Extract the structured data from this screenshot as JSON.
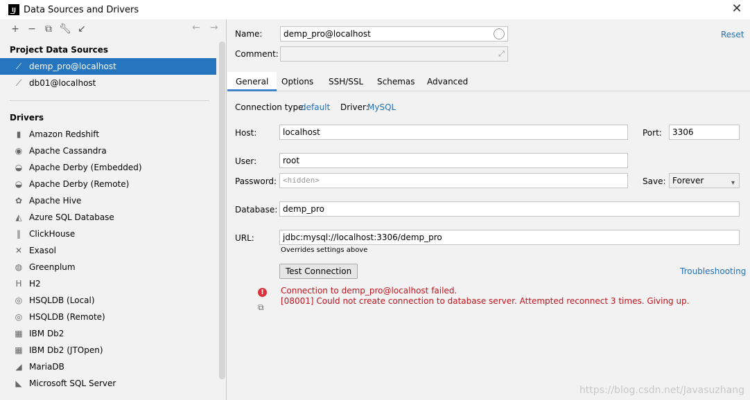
{
  "window": {
    "title": "Data Sources and Drivers",
    "app_icon_text": "IJ"
  },
  "left": {
    "project_section": "Project Data Sources",
    "data_sources": [
      {
        "label": "demp_pro@localhost",
        "icon": "mysql-icon",
        "selected": true
      },
      {
        "label": "db01@localhost",
        "icon": "mysql-icon",
        "selected": false
      }
    ],
    "drivers_section": "Drivers",
    "drivers": [
      {
        "label": "Amazon Redshift",
        "icon": "redshift-icon",
        "glyph": "▮"
      },
      {
        "label": "Apache Cassandra",
        "icon": "cassandra-icon",
        "glyph": "◉"
      },
      {
        "label": "Apache Derby (Embedded)",
        "icon": "derby-icon",
        "glyph": "◒"
      },
      {
        "label": "Apache Derby (Remote)",
        "icon": "derby-icon",
        "glyph": "◒"
      },
      {
        "label": "Apache Hive",
        "icon": "hive-icon",
        "glyph": "✿"
      },
      {
        "label": "Azure SQL Database",
        "icon": "azure-icon",
        "glyph": "◭"
      },
      {
        "label": "ClickHouse",
        "icon": "clickhouse-icon",
        "glyph": "‖"
      },
      {
        "label": "Exasol",
        "icon": "exasol-icon",
        "glyph": "✕"
      },
      {
        "label": "Greenplum",
        "icon": "greenplum-icon",
        "glyph": "◍"
      },
      {
        "label": "H2",
        "icon": "h2-icon",
        "glyph": "H"
      },
      {
        "label": "HSQLDB (Local)",
        "icon": "hsqldb-icon",
        "glyph": "◎"
      },
      {
        "label": "HSQLDB (Remote)",
        "icon": "hsqldb-icon",
        "glyph": "◎"
      },
      {
        "label": "IBM Db2",
        "icon": "ibm-icon",
        "glyph": "▦"
      },
      {
        "label": "IBM Db2 (JTOpen)",
        "icon": "ibm-icon",
        "glyph": "▦"
      },
      {
        "label": "MariaDB",
        "icon": "mariadb-icon",
        "glyph": "◢"
      },
      {
        "label": "Microsoft SQL Server",
        "icon": "mssql-icon",
        "glyph": "◣"
      }
    ]
  },
  "form": {
    "name_label": "Name:",
    "name_value": "demp_pro@localhost",
    "comment_label": "Comment:",
    "reset_link": "Reset",
    "tabs": [
      "General",
      "Options",
      "SSH/SSL",
      "Schemas",
      "Advanced"
    ],
    "connection_type_label": "Connection type:",
    "connection_type_value": "default",
    "driver_label": "Driver:",
    "driver_value": "MySQL",
    "host_label": "Host:",
    "host_value": "localhost",
    "port_label": "Port:",
    "port_value": "3306",
    "user_label": "User:",
    "user_value": "root",
    "password_label": "Password:",
    "password_placeholder": "<hidden>",
    "save_label": "Save:",
    "save_value": "Forever",
    "database_label": "Database:",
    "database_value": "demp_pro",
    "url_label": "URL:",
    "url_value": "jdbc:mysql://localhost:3306/demp_pro",
    "url_hint": "Overrides settings above",
    "test_button": "Test Connection",
    "troubleshooting_link": "Troubleshooting",
    "error_line1": "Connection to demp_pro@localhost failed.",
    "error_line2": "[08001] Could not create connection to database server. Attempted reconnect 3 times. Giving up."
  },
  "watermark": "https://blog.csdn.net/Javasuzhang"
}
